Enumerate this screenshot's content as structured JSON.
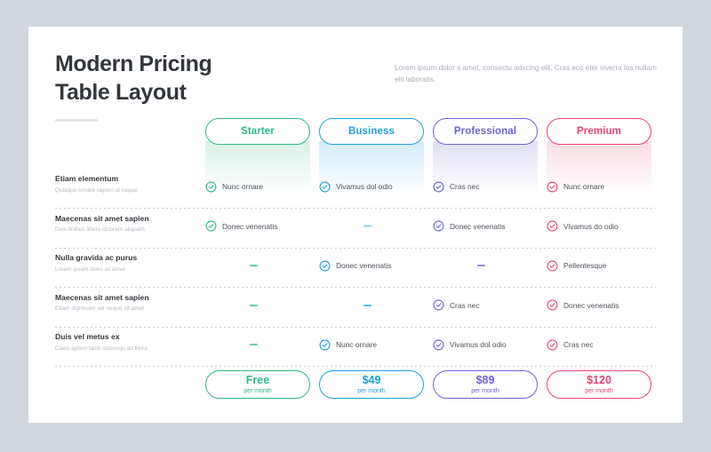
{
  "header": {
    "title": "Modern Pricing\nTable Layout",
    "description": "Lorem ipsum dolor s amet, consectu adscing elit. Cras eco eter viverra las nullam elit laboratis."
  },
  "plans": [
    {
      "name": "Starter",
      "color": "#2fb888",
      "bg_tint": "#d9f0e6",
      "price": "Free",
      "period": "per month"
    },
    {
      "name": "Business",
      "color": "#1e9fe0",
      "bg_tint": "#d3ecfa",
      "price": "$49",
      "period": "per month"
    },
    {
      "name": "Professional",
      "color": "#6b62d6",
      "bg_tint": "#e0dff4",
      "price": "$89",
      "period": "per month"
    },
    {
      "name": "Premium",
      "color": "#e8436f",
      "bg_tint": "#fadde4",
      "price": "$120",
      "period": "per month"
    }
  ],
  "rows": [
    {
      "title": "Etiam elementum",
      "subtitle": "Quisque ornare sapien ut neque",
      "cells": [
        {
          "type": "check",
          "text": "Nunc ornare"
        },
        {
          "type": "check",
          "text": "Vivamus dol odio"
        },
        {
          "type": "check",
          "text": "Cras nec"
        },
        {
          "type": "check",
          "text": "Nunc ornare"
        }
      ]
    },
    {
      "title": "Maecenas sit amet sapien",
      "subtitle": "Duis finibus libero id lorem aliquam",
      "cells": [
        {
          "type": "check",
          "text": "Donec venenatis"
        },
        {
          "type": "dash",
          "text": ""
        },
        {
          "type": "check",
          "text": "Donec venenatis"
        },
        {
          "type": "check",
          "text": "Vivamus do odio"
        }
      ]
    },
    {
      "title": "Nulla gravida ac purus",
      "subtitle": "Lorem ipsum dolor sit amet",
      "cells": [
        {
          "type": "dash",
          "text": ""
        },
        {
          "type": "check",
          "text": "Donec venenatis"
        },
        {
          "type": "dash",
          "text": ""
        },
        {
          "type": "check",
          "text": "Pellentesque"
        }
      ]
    },
    {
      "title": "Maecenas sit amet sapien",
      "subtitle": "Etiam dignissim vel neque sit amet",
      "cells": [
        {
          "type": "dash",
          "text": ""
        },
        {
          "type": "dash",
          "text": ""
        },
        {
          "type": "check",
          "text": "Cras nec"
        },
        {
          "type": "check",
          "text": "Donec venenatis"
        }
      ]
    },
    {
      "title": "Duis vel metus ex",
      "subtitle": "Class aptent taciti sociosqu ad litora",
      "cells": [
        {
          "type": "dash",
          "text": ""
        },
        {
          "type": "check",
          "text": "Nunc ornare"
        },
        {
          "type": "check",
          "text": "Vivamus dol odio"
        },
        {
          "type": "check",
          "text": "Cras nec"
        }
      ]
    }
  ],
  "icons": {
    "check": "check-circle-icon",
    "dash": "dash-icon"
  }
}
